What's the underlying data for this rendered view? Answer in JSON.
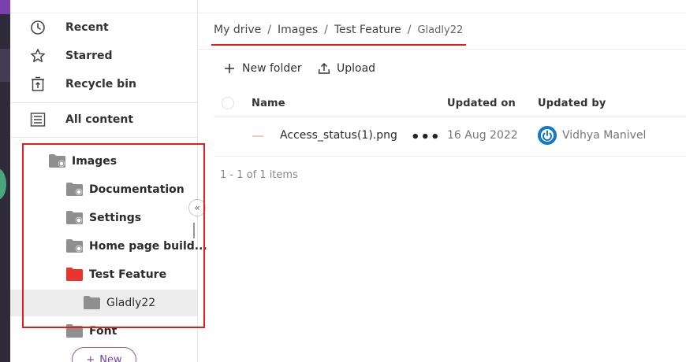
{
  "sidebar": {
    "nav": [
      {
        "label": "Recent",
        "icon": "clock-icon"
      },
      {
        "label": "Starred",
        "icon": "star-icon"
      },
      {
        "label": "Recycle bin",
        "icon": "recycle-bin-icon"
      },
      {
        "label": "All content",
        "icon": "all-content-icon"
      }
    ],
    "tree": [
      {
        "label": "Images",
        "icon": "shared-folder-icon"
      },
      {
        "label": "Documentation",
        "icon": "shared-folder-icon"
      },
      {
        "label": "Settings",
        "icon": "shared-folder-icon"
      },
      {
        "label": "Home page build...",
        "icon": "shared-folder-icon"
      },
      {
        "label": "Test Feature",
        "icon": "folder-icon-red"
      },
      {
        "label": "Gladly22",
        "icon": "folder-icon",
        "selected": true
      },
      {
        "label": "Font",
        "icon": "folder-icon"
      }
    ],
    "new_label": "New",
    "collapse_icon": "double-chevron-left-icon"
  },
  "breadcrumb": [
    "My drive",
    "Images",
    "Test Feature",
    "Gladly22"
  ],
  "toolbar": {
    "new_folder_label": "New folder",
    "upload_label": "Upload"
  },
  "table": {
    "columns": [
      "Name",
      "Updated on",
      "Updated by"
    ],
    "rows": [
      {
        "name": "Access_status(1).png",
        "updated_on": "16 Aug 2022",
        "updated_by": "Vidhya Manivel"
      }
    ]
  },
  "pager_text": "1 - 1 of 1 items",
  "colors": {
    "accent": "#7b3fb0",
    "highlight": "#e01e1e",
    "red_folder": "#e8352e",
    "grey_folder": "#8f8f8f",
    "user_icon": "#1778c5"
  }
}
